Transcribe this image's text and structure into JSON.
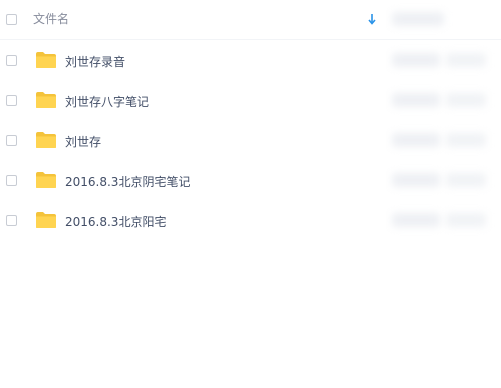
{
  "header": {
    "column_label": "文件名",
    "sort_icon": "arrow-down-icon"
  },
  "files": [
    {
      "name": "刘世存录音",
      "type": "folder",
      "icon": "folder-icon"
    },
    {
      "name": "刘世存八字笔记",
      "type": "folder",
      "icon": "folder-icon"
    },
    {
      "name": "刘世存",
      "type": "folder",
      "icon": "folder-icon"
    },
    {
      "name": "2016.8.3北京阴宅笔记",
      "type": "folder",
      "icon": "folder-icon"
    },
    {
      "name": "2016.8.3北京阳宅",
      "type": "folder",
      "icon": "folder-icon"
    }
  ],
  "colors": {
    "folder": "#ffd451",
    "folder_tab": "#f4c33b",
    "sort_arrow": "#2a93e8",
    "text": "#424e67",
    "header_text": "#878c9c"
  }
}
